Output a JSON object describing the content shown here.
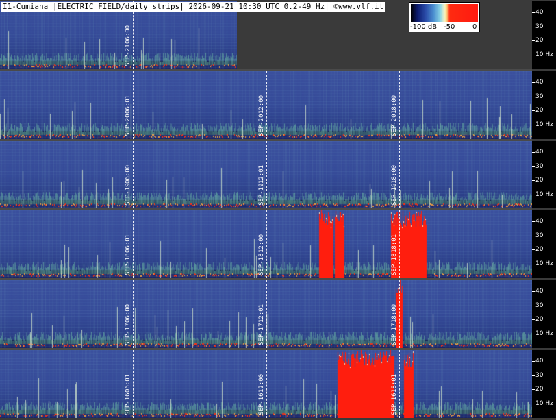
{
  "header": {
    "title": "I1-Cumiana |ELECTRIC FIELD/daily strips| 2026-09-21 10:30 UTC 0.2-49 Hz| ©www.vlf.it"
  },
  "colorbar": {
    "labels": [
      "-100 dB",
      "-50",
      "0"
    ]
  },
  "chart_data": {
    "type": "heatmap",
    "title": "I1-Cumiana |ELECTRIC FIELD/daily strips| 2026-09-21 10:30 UTC 0.2-49 Hz| ©www.vlf.it",
    "yaxis_ticks": [
      "40",
      "30",
      "20",
      "10 Hz"
    ],
    "ylim_hz": [
      0.2,
      49
    ],
    "color_scale_db": [
      -100,
      0
    ],
    "strips": [
      {
        "date": "SEP-21",
        "partial_fraction": 0.445,
        "markers": [
          {
            "label": "SEP-21",
            "time": "06:00",
            "frac": 0.25
          }
        ],
        "red_events": []
      },
      {
        "date": "SEP-20",
        "partial_fraction": 1.0,
        "markers": [
          {
            "label": "SEP-20",
            "time": "06:01",
            "frac": 0.25
          },
          {
            "label": "SEP-20",
            "time": "12:00",
            "frac": 0.5
          },
          {
            "label": "SEP-20",
            "time": "18:00",
            "frac": 0.75
          }
        ],
        "red_events": []
      },
      {
        "date": "SEP-19",
        "partial_fraction": 1.0,
        "markers": [
          {
            "label": "SEP-19",
            "time": "06:00",
            "frac": 0.25
          },
          {
            "label": "SEP-19",
            "time": "12:01",
            "frac": 0.5
          },
          {
            "label": "SEP-19",
            "time": "18:00",
            "frac": 0.75
          }
        ],
        "red_events": []
      },
      {
        "date": "SEP-18",
        "partial_fraction": 1.0,
        "markers": [
          {
            "label": "SEP-18",
            "time": "06:01",
            "frac": 0.25
          },
          {
            "label": "SEP-18",
            "time": "12:00",
            "frac": 0.5
          },
          {
            "label": "SEP-18",
            "time": "18:01",
            "frac": 0.75
          }
        ],
        "red_events": [
          [
            0.6,
            0.625
          ],
          [
            0.63,
            0.645
          ],
          [
            0.735,
            0.8
          ]
        ]
      },
      {
        "date": "SEP-17",
        "partial_fraction": 1.0,
        "markers": [
          {
            "label": "SEP-17",
            "time": "06:00",
            "frac": 0.25
          },
          {
            "label": "SEP-17",
            "time": "12:01",
            "frac": 0.5
          },
          {
            "label": "SEP-17",
            "time": "18:00",
            "frac": 0.75
          }
        ],
        "red_events": [
          [
            0.745,
            0.755
          ]
        ]
      },
      {
        "date": "SEP-16",
        "partial_fraction": 1.0,
        "markers": [
          {
            "label": "SEP-16",
            "time": "06:01",
            "frac": 0.25
          },
          {
            "label": "SEP-16",
            "time": "12:00",
            "frac": 0.5
          },
          {
            "label": "SEP-16",
            "time": "18:01",
            "frac": 0.75
          }
        ],
        "red_events": [
          [
            0.635,
            0.74
          ],
          [
            0.76,
            0.775
          ]
        ]
      }
    ]
  }
}
